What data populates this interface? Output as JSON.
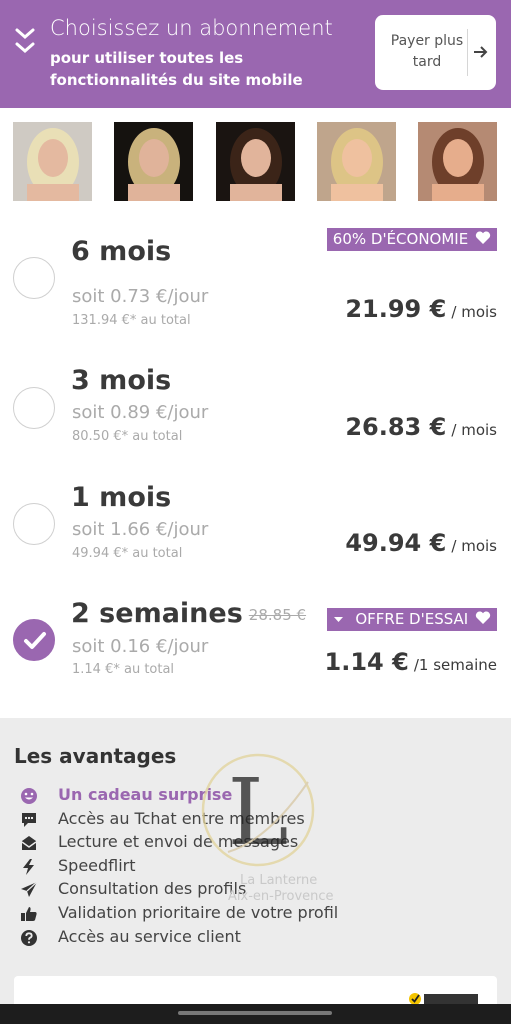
{
  "header": {
    "title": "Choisissez un abonnement",
    "subtitle": "pour utiliser toutes les fonctionnalités du site mobile",
    "later_button": "Payer plus tard",
    "icons": [
      "chevron-double-down-icon",
      "arrow-right-icon"
    ]
  },
  "photos": [
    {
      "name": "profile-photo-1",
      "hair": "#e9dfb6",
      "skin": "#e4b9a0",
      "bg": "#cfcac3"
    },
    {
      "name": "profile-photo-2",
      "hair": "#c9b27c",
      "skin": "#e0b39a",
      "bg": "#15120f"
    },
    {
      "name": "profile-photo-3",
      "hair": "#3b2418",
      "skin": "#e1b49b",
      "bg": "#1a1411"
    },
    {
      "name": "profile-photo-4",
      "hair": "#ddc486",
      "skin": "#efc19f",
      "bg": "#bfa58c"
    },
    {
      "name": "profile-photo-5",
      "hair": "#6e3f2a",
      "skin": "#e6ad8c",
      "bg": "#b58a73"
    }
  ],
  "plans": [
    {
      "name": "6 mois",
      "daily": "soit 0.73 €/jour",
      "total": "131.94 €* au total",
      "price": "21.99 €",
      "period": "/ mois",
      "badge": "60% D'ÉCONOMIE",
      "old_price": "",
      "selected": false
    },
    {
      "name": "3 mois",
      "daily": "soit 0.89 €/jour",
      "total": "80.50 €* au total",
      "price": "26.83 €",
      "period": "/ mois",
      "badge": "",
      "old_price": "",
      "selected": false
    },
    {
      "name": "1 mois",
      "daily": "soit 1.66 €/jour",
      "total": "49.94 €* au total",
      "price": "49.94 €",
      "period": "/ mois",
      "badge": "",
      "old_price": "",
      "selected": false
    },
    {
      "name": "2 semaines",
      "daily": "soit 0.16 €/jour",
      "total": "1.14 €* au total",
      "price": "1.14 €",
      "period": "/1 semaine",
      "badge": "OFFRE D'ESSAI",
      "old_price": "28.85 €",
      "selected": true
    }
  ],
  "advantages": {
    "title": "Les avantages",
    "items": [
      {
        "label": "Un cadeau surprise",
        "icon": "smiley-icon",
        "highlight": true
      },
      {
        "label": "Accès au Tchat entre membres",
        "icon": "chat-bubble-icon",
        "highlight": false
      },
      {
        "label": "Lecture et envoi de messages",
        "icon": "envelope-icon",
        "highlight": false
      },
      {
        "label": "Speedflirt",
        "icon": "lightning-icon",
        "highlight": false
      },
      {
        "label": "Consultation des profils",
        "icon": "paper-plane-icon",
        "highlight": false
      },
      {
        "label": "Validation prioritaire de votre profil",
        "icon": "thumbs-up-icon",
        "highlight": false
      },
      {
        "label": "Accès au service client",
        "icon": "question-circle-icon",
        "highlight": false
      }
    ]
  },
  "watermark": {
    "letter": "L",
    "line1": "La Lanterne",
    "line2": "Aix-en-Provence"
  },
  "colors": {
    "accent": "#9a67b0",
    "text": "#3a3a3a",
    "muted": "#aaaaaa",
    "panel": "#ececec"
  }
}
